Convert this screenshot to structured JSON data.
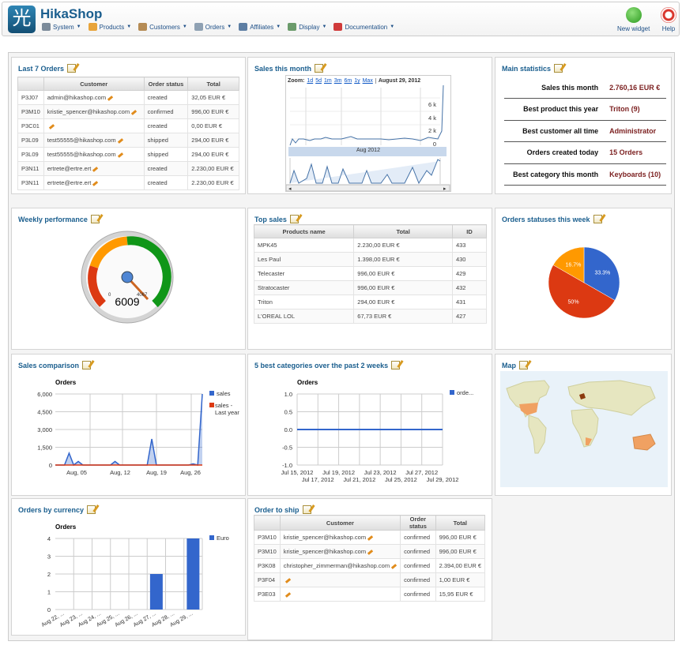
{
  "app": {
    "title": "HikaShop",
    "logo_glyph": "光"
  },
  "menu": [
    {
      "label": "System",
      "icon": "system-icon",
      "color": "#7b8a99"
    },
    {
      "label": "Products",
      "icon": "products-icon",
      "color": "#e8a43a"
    },
    {
      "label": "Customers",
      "icon": "customers-icon",
      "color": "#b58b54"
    },
    {
      "label": "Orders",
      "icon": "orders-icon",
      "color": "#8fa1b3"
    },
    {
      "label": "Affiliates",
      "icon": "affiliates-icon",
      "color": "#5d7ea3"
    },
    {
      "label": "Display",
      "icon": "display-icon",
      "color": "#6b9b6b"
    },
    {
      "label": "Documentation",
      "icon": "lifebuoy-icon",
      "color": "#d03b3b"
    }
  ],
  "toolbar": {
    "new_widget": "New widget",
    "help": "Help"
  },
  "last_orders": {
    "title": "Last 7 Orders",
    "columns": [
      "Customer",
      "Order status",
      "Total"
    ],
    "rows": [
      {
        "id": "P3J07",
        "customer": "admin@hikashop.com",
        "status": "created",
        "total": "32,05 EUR €"
      },
      {
        "id": "P3M10",
        "customer": "kristie_spencer@hikashop.com",
        "status": "confirmed",
        "total": "996,00 EUR €"
      },
      {
        "id": "P3C01",
        "customer": "",
        "status": "created",
        "total": "0,00 EUR €"
      },
      {
        "id": "P3L09",
        "customer": "test55555@hikashop.com",
        "status": "shipped",
        "total": "294,00 EUR €"
      },
      {
        "id": "P3L09",
        "customer": "test55555@hikashop.com",
        "status": "shipped",
        "total": "294,00 EUR €"
      },
      {
        "id": "P3N11",
        "customer": "ertrete@ertre.ert",
        "status": "created",
        "total": "2.230,00 EUR €"
      },
      {
        "id": "P3N11",
        "customer": "ertrete@ertre.ert",
        "status": "created",
        "total": "2.230,00 EUR €"
      }
    ]
  },
  "sales_month": {
    "title": "Sales this month",
    "zoom_label": "Zoom:",
    "zoom_options": [
      "1d",
      "5d",
      "1m",
      "3m",
      "6m",
      "1y",
      "Max"
    ],
    "date": "August 29, 2012",
    "y_ticks": [
      "6 k",
      "4 k",
      "2 k",
      "0"
    ],
    "nav_label": "Aug 2012"
  },
  "main_stats": {
    "title": "Main statistics",
    "rows": [
      {
        "label": "Sales this month",
        "value": "2.760,16 EUR €"
      },
      {
        "label": "Best product this year",
        "value": "Triton (9)"
      },
      {
        "label": "Best customer all time",
        "value": "Administrator"
      },
      {
        "label": "Orders created today",
        "value": "15 Orders"
      },
      {
        "label": "Best category this month",
        "value": "Keyboards (10)"
      }
    ]
  },
  "weekly": {
    "title": "Weekly performance",
    "value": "6009",
    "min_label": "0",
    "max_label": "4067"
  },
  "top_sales": {
    "title": "Top sales",
    "columns": [
      "Products name",
      "Total",
      "ID"
    ],
    "rows": [
      {
        "name": "MPK45",
        "total": "2.230,00 EUR €",
        "id": "433"
      },
      {
        "name": "Les Paul",
        "total": "1.398,00 EUR €",
        "id": "430"
      },
      {
        "name": "Telecaster",
        "total": "996,00 EUR €",
        "id": "429"
      },
      {
        "name": "Stratocaster",
        "total": "996,00 EUR €",
        "id": "432"
      },
      {
        "name": "Triton",
        "total": "294,00 EUR €",
        "id": "431"
      },
      {
        "name": "L'OREAL LOL",
        "total": "67,73 EUR €",
        "id": "427"
      }
    ]
  },
  "order_status": {
    "title": "Orders statuses this week",
    "chart_data": {
      "type": "pie",
      "slices": [
        {
          "value": 33.3,
          "label": "33.3%",
          "color": "#3366cc"
        },
        {
          "value": 50,
          "label": "50%",
          "color": "#dc3912"
        },
        {
          "value": 16.7,
          "label": "16.7%",
          "color": "#ff9900"
        }
      ]
    }
  },
  "sales_comparison": {
    "title": "Sales comparison",
    "chart_data": {
      "type": "area",
      "title": "Orders",
      "x_ticks": [
        "Aug, 05",
        "Aug, 12",
        "Aug, 19",
        "Aug, 26"
      ],
      "y_ticks": [
        "6,000",
        "4,500",
        "3,000",
        "1,500",
        "0"
      ],
      "ylim": [
        0,
        6000
      ],
      "series": [
        {
          "name": "sales",
          "color": "#3366cc",
          "values": [
            0,
            0,
            0,
            1000,
            0,
            300,
            0,
            0,
            0,
            0,
            0,
            0,
            0,
            300,
            0,
            0,
            0,
            0,
            0,
            0,
            0,
            2200,
            0,
            0,
            0,
            0,
            0,
            0,
            0,
            0,
            100,
            0,
            6000
          ]
        },
        {
          "name": "sales - Last year",
          "color": "#dc3912",
          "values": [
            0,
            0,
            0,
            0,
            0,
            0,
            0,
            0,
            0,
            0,
            0,
            0,
            0,
            0,
            0,
            0,
            0,
            0,
            0,
            0,
            0,
            0,
            0,
            0,
            0,
            0,
            0,
            0,
            0,
            0,
            0,
            0,
            0
          ]
        }
      ]
    }
  },
  "best_categories": {
    "title": "5 best categories over the past 2 weeks",
    "chart_data": {
      "type": "line",
      "title": "Orders",
      "legend": [
        "orde..."
      ],
      "y_ticks": [
        "1.0",
        "0.5",
        "0.0",
        "-0.5",
        "-1.0"
      ],
      "ylim": [
        -1,
        1
      ],
      "x_ticks_top": [
        "Jul 15, 2012",
        "Jul 19, 2012",
        "Jul 23, 2012",
        "Jul 27, 2012"
      ],
      "x_ticks_bottom": [
        "Jul 17, 2012",
        "Jul 21, 2012",
        "Jul 25, 2012",
        "Jul 29, 2012"
      ],
      "series": [
        {
          "name": "orde...",
          "color": "#3366cc",
          "values": [
            0,
            0
          ]
        }
      ]
    }
  },
  "map": {
    "title": "Map"
  },
  "currency": {
    "title": "Orders by currency",
    "chart_data": {
      "type": "bar",
      "title": "Orders",
      "categories": [
        "Aug 22, ...",
        "Aug 23, ...",
        "Aug 24, ...",
        "Aug 25, ...",
        "Aug 26, ...",
        "Aug 27, ...",
        "Aug 28, ...",
        "Aug 29, ..."
      ],
      "values": [
        0,
        0,
        0,
        0,
        0,
        2,
        0,
        4
      ],
      "y_ticks": [
        "4",
        "3",
        "2",
        "1",
        "0"
      ],
      "ylim": [
        0,
        4
      ],
      "series": [
        {
          "name": "Euro",
          "color": "#3366cc"
        }
      ]
    }
  },
  "to_ship": {
    "title": "Order to ship",
    "columns": [
      "Customer",
      "Order status",
      "Total"
    ],
    "rows": [
      {
        "id": "P3M10",
        "customer": "kristie_spencer@hikashop.com",
        "status": "confirmed",
        "total": "996,00 EUR €"
      },
      {
        "id": "P3M10",
        "customer": "kristie_spencer@hikashop.com",
        "status": "confirmed",
        "total": "996,00 EUR €"
      },
      {
        "id": "P3K08",
        "customer": "christopher_zimmerman@hikashop.com",
        "status": "confirmed",
        "total": "2.394,00 EUR €"
      },
      {
        "id": "P3F04",
        "customer": "",
        "status": "confirmed",
        "total": "1,00 EUR €"
      },
      {
        "id": "P3E03",
        "customer": "",
        "status": "confirmed",
        "total": "15,95 EUR €"
      }
    ]
  }
}
